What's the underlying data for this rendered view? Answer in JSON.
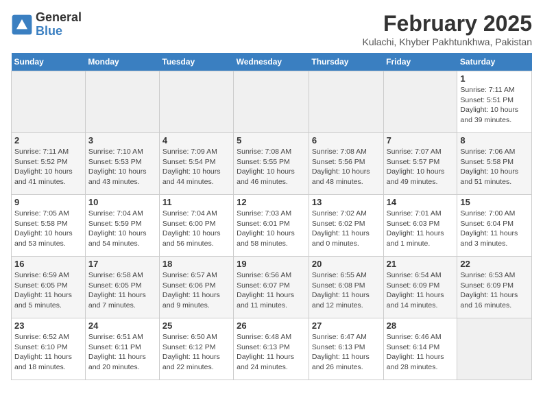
{
  "header": {
    "logo_general": "General",
    "logo_blue": "Blue",
    "title": "February 2025",
    "subtitle": "Kulachi, Khyber Pakhtunkhwa, Pakistan"
  },
  "days_of_week": [
    "Sunday",
    "Monday",
    "Tuesday",
    "Wednesday",
    "Thursday",
    "Friday",
    "Saturday"
  ],
  "weeks": [
    [
      {
        "day": "",
        "info": ""
      },
      {
        "day": "",
        "info": ""
      },
      {
        "day": "",
        "info": ""
      },
      {
        "day": "",
        "info": ""
      },
      {
        "day": "",
        "info": ""
      },
      {
        "day": "",
        "info": ""
      },
      {
        "day": "1",
        "info": "Sunrise: 7:11 AM\nSunset: 5:51 PM\nDaylight: 10 hours and 39 minutes."
      }
    ],
    [
      {
        "day": "2",
        "info": "Sunrise: 7:11 AM\nSunset: 5:52 PM\nDaylight: 10 hours and 41 minutes."
      },
      {
        "day": "3",
        "info": "Sunrise: 7:10 AM\nSunset: 5:53 PM\nDaylight: 10 hours and 43 minutes."
      },
      {
        "day": "4",
        "info": "Sunrise: 7:09 AM\nSunset: 5:54 PM\nDaylight: 10 hours and 44 minutes."
      },
      {
        "day": "5",
        "info": "Sunrise: 7:08 AM\nSunset: 5:55 PM\nDaylight: 10 hours and 46 minutes."
      },
      {
        "day": "6",
        "info": "Sunrise: 7:08 AM\nSunset: 5:56 PM\nDaylight: 10 hours and 48 minutes."
      },
      {
        "day": "7",
        "info": "Sunrise: 7:07 AM\nSunset: 5:57 PM\nDaylight: 10 hours and 49 minutes."
      },
      {
        "day": "8",
        "info": "Sunrise: 7:06 AM\nSunset: 5:58 PM\nDaylight: 10 hours and 51 minutes."
      }
    ],
    [
      {
        "day": "9",
        "info": "Sunrise: 7:05 AM\nSunset: 5:58 PM\nDaylight: 10 hours and 53 minutes."
      },
      {
        "day": "10",
        "info": "Sunrise: 7:04 AM\nSunset: 5:59 PM\nDaylight: 10 hours and 54 minutes."
      },
      {
        "day": "11",
        "info": "Sunrise: 7:04 AM\nSunset: 6:00 PM\nDaylight: 10 hours and 56 minutes."
      },
      {
        "day": "12",
        "info": "Sunrise: 7:03 AM\nSunset: 6:01 PM\nDaylight: 10 hours and 58 minutes."
      },
      {
        "day": "13",
        "info": "Sunrise: 7:02 AM\nSunset: 6:02 PM\nDaylight: 11 hours and 0 minutes."
      },
      {
        "day": "14",
        "info": "Sunrise: 7:01 AM\nSunset: 6:03 PM\nDaylight: 11 hours and 1 minute."
      },
      {
        "day": "15",
        "info": "Sunrise: 7:00 AM\nSunset: 6:04 PM\nDaylight: 11 hours and 3 minutes."
      }
    ],
    [
      {
        "day": "16",
        "info": "Sunrise: 6:59 AM\nSunset: 6:05 PM\nDaylight: 11 hours and 5 minutes."
      },
      {
        "day": "17",
        "info": "Sunrise: 6:58 AM\nSunset: 6:05 PM\nDaylight: 11 hours and 7 minutes."
      },
      {
        "day": "18",
        "info": "Sunrise: 6:57 AM\nSunset: 6:06 PM\nDaylight: 11 hours and 9 minutes."
      },
      {
        "day": "19",
        "info": "Sunrise: 6:56 AM\nSunset: 6:07 PM\nDaylight: 11 hours and 11 minutes."
      },
      {
        "day": "20",
        "info": "Sunrise: 6:55 AM\nSunset: 6:08 PM\nDaylight: 11 hours and 12 minutes."
      },
      {
        "day": "21",
        "info": "Sunrise: 6:54 AM\nSunset: 6:09 PM\nDaylight: 11 hours and 14 minutes."
      },
      {
        "day": "22",
        "info": "Sunrise: 6:53 AM\nSunset: 6:09 PM\nDaylight: 11 hours and 16 minutes."
      }
    ],
    [
      {
        "day": "23",
        "info": "Sunrise: 6:52 AM\nSunset: 6:10 PM\nDaylight: 11 hours and 18 minutes."
      },
      {
        "day": "24",
        "info": "Sunrise: 6:51 AM\nSunset: 6:11 PM\nDaylight: 11 hours and 20 minutes."
      },
      {
        "day": "25",
        "info": "Sunrise: 6:50 AM\nSunset: 6:12 PM\nDaylight: 11 hours and 22 minutes."
      },
      {
        "day": "26",
        "info": "Sunrise: 6:48 AM\nSunset: 6:13 PM\nDaylight: 11 hours and 24 minutes."
      },
      {
        "day": "27",
        "info": "Sunrise: 6:47 AM\nSunset: 6:13 PM\nDaylight: 11 hours and 26 minutes."
      },
      {
        "day": "28",
        "info": "Sunrise: 6:46 AM\nSunset: 6:14 PM\nDaylight: 11 hours and 28 minutes."
      },
      {
        "day": "",
        "info": ""
      }
    ]
  ]
}
